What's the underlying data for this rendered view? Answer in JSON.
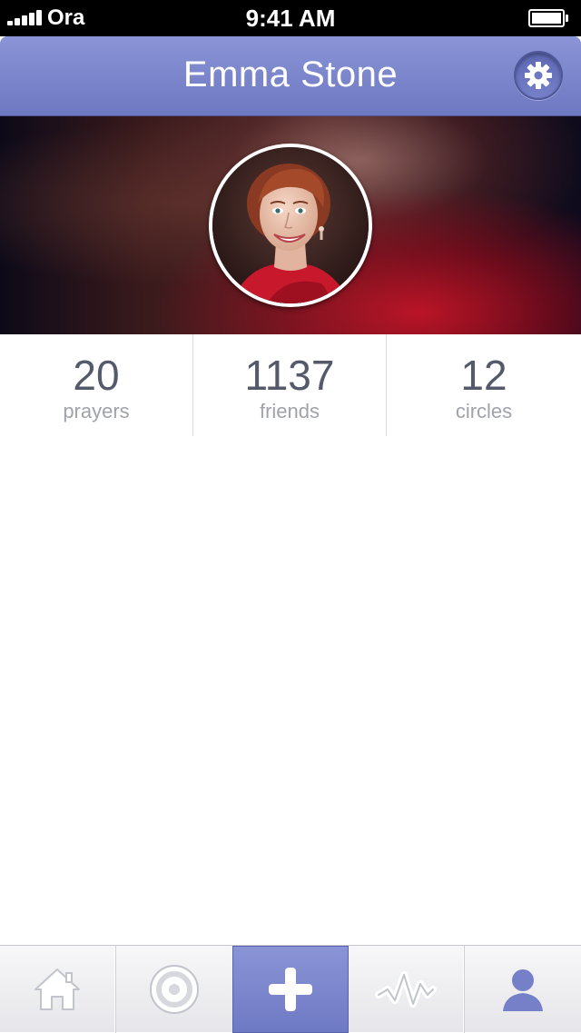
{
  "status_bar": {
    "carrier": "Ora",
    "time": "9:41 AM",
    "battery_level": 1.0
  },
  "nav": {
    "title": "Emma Stone",
    "settings_icon": "gear-icon"
  },
  "profile": {
    "avatar_icon": "profile-photo"
  },
  "stats": [
    {
      "value": "20",
      "label": "prayers"
    },
    {
      "value": "1137",
      "label": "friends"
    },
    {
      "value": "12",
      "label": "circles"
    }
  ],
  "tab_bar": {
    "tabs": [
      {
        "icon": "home-icon",
        "active": false
      },
      {
        "icon": "target-icon",
        "active": false
      },
      {
        "icon": "plus-icon",
        "active": true
      },
      {
        "icon": "activity-icon",
        "active": false
      },
      {
        "icon": "person-icon",
        "active": false
      }
    ]
  },
  "colors": {
    "accent": "#7580c8",
    "stat_value": "#545a6a",
    "stat_label": "#a0a2ac"
  }
}
